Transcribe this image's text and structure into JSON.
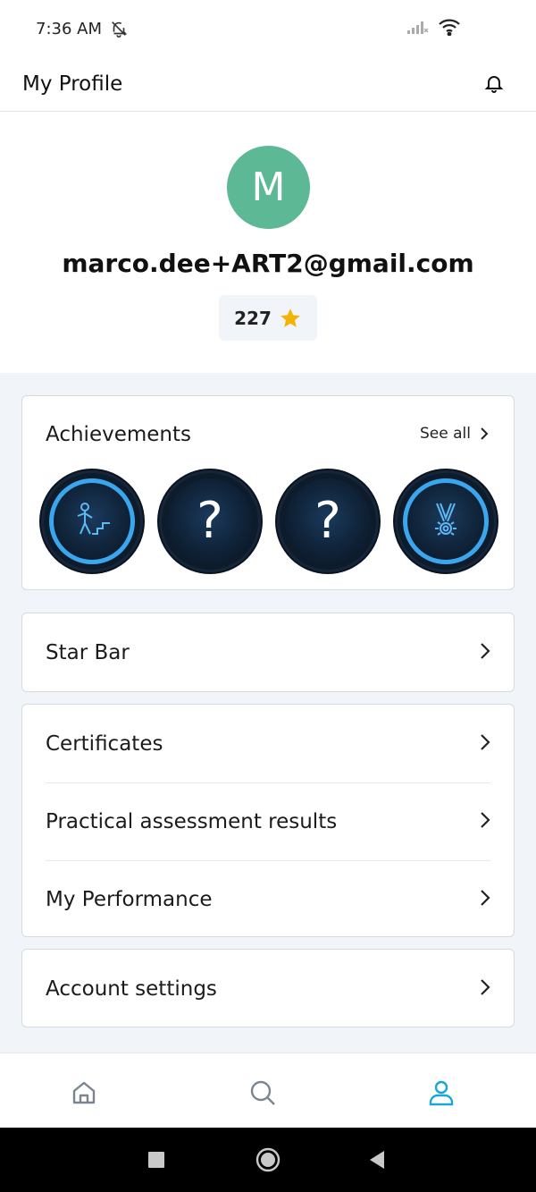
{
  "status": {
    "time": "7:36 AM"
  },
  "app": {
    "title": "My Profile"
  },
  "profile": {
    "initial": "M",
    "email": "marco.dee+ART2@gmail.com",
    "points": "227",
    "avatar_color": "#5cb895",
    "star_color": "#f5b301"
  },
  "achievements": {
    "title": "Achievements",
    "see_all": "See all",
    "badges": [
      {
        "name": "stairs-badge",
        "state": "unlocked"
      },
      {
        "name": "unknown-badge",
        "label": "?",
        "state": "locked"
      },
      {
        "name": "unknown-badge",
        "label": "?",
        "state": "locked"
      },
      {
        "name": "medal-badge",
        "state": "unlocked"
      }
    ]
  },
  "menu": {
    "star_bar": "Star Bar",
    "certificates": "Certificates",
    "practical": "Practical assessment results",
    "performance": "My Performance",
    "account": "Account settings"
  },
  "nav": {
    "items": [
      "home-icon",
      "search-icon",
      "profile-icon"
    ],
    "active_color": "#1aa7d6",
    "inactive_color": "#7a8591"
  }
}
